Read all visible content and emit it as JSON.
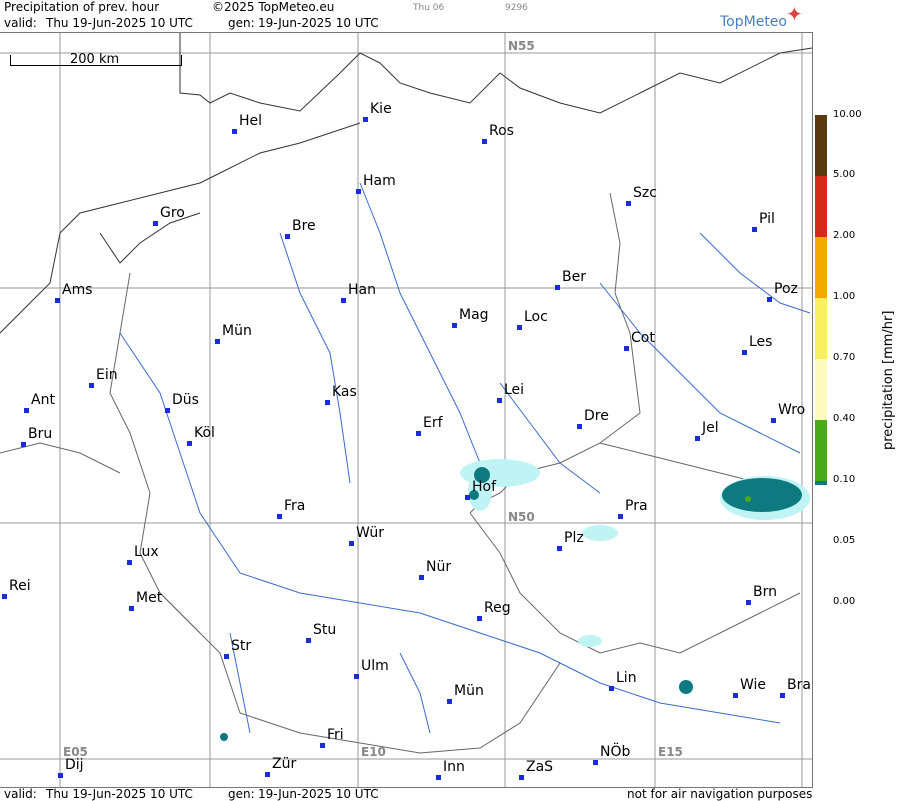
{
  "header": {
    "title": "Precipitation of prev. hour",
    "copyright": "©2025 TopMeteo.eu",
    "small_day": "Thu 06",
    "small_code": "9296",
    "valid_label": "valid:",
    "valid_value": "Thu  19-Jun-2025  10 UTC",
    "gen_label": "gen:",
    "gen_value": "19-Jun-2025 10 UTC",
    "logo": "TopMeteo"
  },
  "map": {
    "scale_label": "200 km",
    "grid_labels": [
      "N55",
      "N50",
      "E05",
      "E10",
      "E15"
    ],
    "cities": [
      {
        "name": "Kie"
      },
      {
        "name": "Hel"
      },
      {
        "name": "Ros"
      },
      {
        "name": "Ham"
      },
      {
        "name": "Szc"
      },
      {
        "name": "Gro"
      },
      {
        "name": "Bre"
      },
      {
        "name": "Pil"
      },
      {
        "name": "Ber"
      },
      {
        "name": "Ams"
      },
      {
        "name": "Han"
      },
      {
        "name": "Poz"
      },
      {
        "name": "Mag"
      },
      {
        "name": "Loc"
      },
      {
        "name": "Mün"
      },
      {
        "name": "Cot"
      },
      {
        "name": "Les"
      },
      {
        "name": "Ein"
      },
      {
        "name": "Kas"
      },
      {
        "name": "Lei"
      },
      {
        "name": "Ant"
      },
      {
        "name": "Düs"
      },
      {
        "name": "Wro"
      },
      {
        "name": "Dre"
      },
      {
        "name": "Erf"
      },
      {
        "name": "Bru"
      },
      {
        "name": "Köl"
      },
      {
        "name": "Jel"
      },
      {
        "name": "Hof"
      },
      {
        "name": "Fra"
      },
      {
        "name": "Pra"
      },
      {
        "name": "Wür"
      },
      {
        "name": "Plz"
      },
      {
        "name": "Lux"
      },
      {
        "name": "Nür"
      },
      {
        "name": "Rei"
      },
      {
        "name": "Met"
      },
      {
        "name": "Brn"
      },
      {
        "name": "Reg"
      },
      {
        "name": "Stu"
      },
      {
        "name": "Str"
      },
      {
        "name": "Ulm"
      },
      {
        "name": "Lin"
      },
      {
        "name": "Mün"
      },
      {
        "name": "Wie"
      },
      {
        "name": "Bra"
      },
      {
        "name": "Fri"
      },
      {
        "name": "NÖb"
      },
      {
        "name": "Dij"
      },
      {
        "name": "Zür"
      },
      {
        "name": "Inn"
      },
      {
        "name": "ZaS"
      }
    ]
  },
  "legend": {
    "title": "precipitation  [mm/hr]",
    "ticks": [
      "10.00",
      "5.00",
      "2.00",
      "1.00",
      "0.70",
      "0.40",
      "0.10",
      "0.05",
      "0.00"
    ],
    "colors": [
      "#5a3a10",
      "#d42a1a",
      "#f5a800",
      "#f8f060",
      "#fbfbc0",
      "#4aaa1a",
      "#0e7a80",
      "#c0f4f4",
      "#ffffff"
    ]
  },
  "footer": {
    "valid_label": "valid:",
    "valid_value": "Thu  19-Jun-2025  10 UTC",
    "gen_label": "gen:",
    "gen_value": "19-Jun-2025 10 UTC",
    "disclaimer": "not for air navigation purposes"
  }
}
